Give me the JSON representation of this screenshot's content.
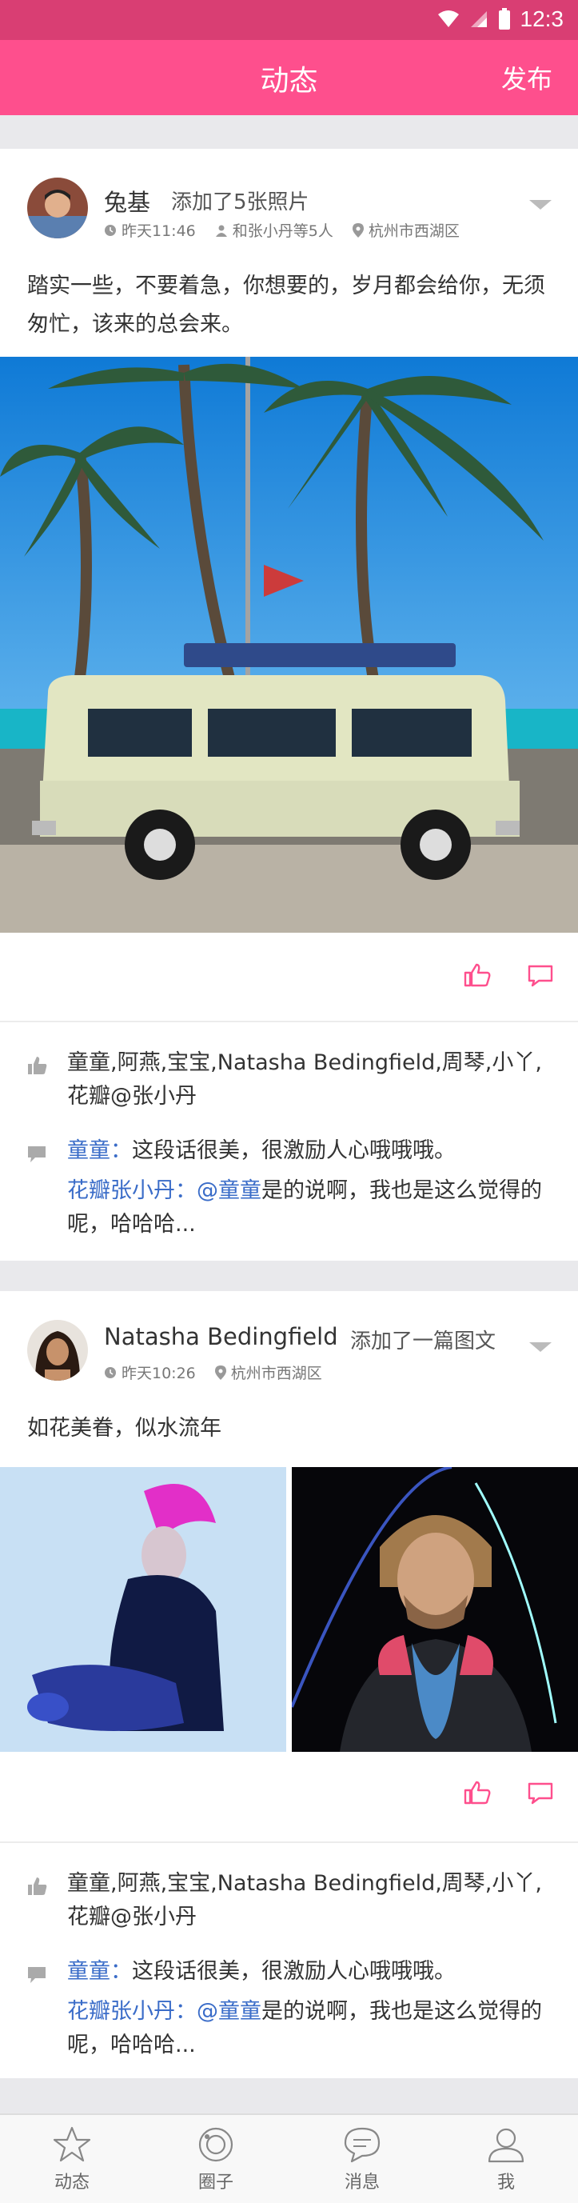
{
  "status_bar": {
    "time": "12:3"
  },
  "nav": {
    "title": "动态",
    "publish": "发布"
  },
  "posts": [
    {
      "name": "兔基",
      "action": "添加了5张照片",
      "time": "昨天11:46",
      "with": "和张小丹等5人",
      "location": "杭州市西湖区",
      "text": "踏实一些，不要着急，你想要的，岁月都会给你，无须匆忙，该来的总会来。",
      "likes": "童童,阿燕,宝宝,Natasha Bedingfield,周琴,小丫,花瓣@张小丹",
      "comments": [
        {
          "name": "童童：",
          "mention": "",
          "text": "这段话很美，很激励人心哦哦哦。"
        },
        {
          "name": "花瓣张小丹：",
          "mention": "@童童",
          "text": "是的说啊，我也是这么觉得的呢，哈哈哈..."
        }
      ]
    },
    {
      "name": "Natasha Bedingfield",
      "action": "添加了一篇图文",
      "time": "昨天10:26",
      "location": "杭州市西湖区",
      "text": "如花美眷，似水流年",
      "likes": "童童,阿燕,宝宝,Natasha Bedingfield,周琴,小丫,花瓣@张小丹",
      "comments": [
        {
          "name": "童童：",
          "mention": "",
          "text": "这段话很美，很激励人心哦哦哦。"
        },
        {
          "name": "花瓣张小丹：",
          "mention": "@童童",
          "text": "是的说啊，我也是这么觉得的呢，哈哈哈..."
        }
      ]
    }
  ],
  "tabs": [
    {
      "label": "动态",
      "icon": "star-icon"
    },
    {
      "label": "圈子",
      "icon": "circle-icon"
    },
    {
      "label": "消息",
      "icon": "chat-icon"
    },
    {
      "label": "我",
      "icon": "person-icon"
    }
  ],
  "colors": {
    "brand": "#fe4f8d",
    "status_bar": "#d93e73",
    "link": "#3a6cc8"
  }
}
